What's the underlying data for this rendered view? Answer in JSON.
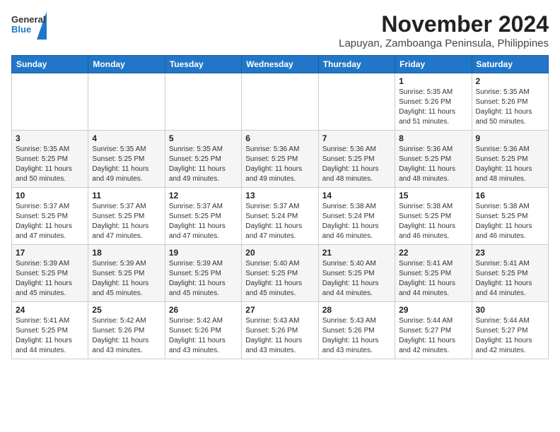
{
  "header": {
    "logo": {
      "general": "General",
      "blue": "Blue"
    },
    "title": "November 2024",
    "subtitle": "Lapuyan, Zamboanga Peninsula, Philippines"
  },
  "days_of_week": [
    "Sunday",
    "Monday",
    "Tuesday",
    "Wednesday",
    "Thursday",
    "Friday",
    "Saturday"
  ],
  "weeks": [
    [
      {
        "day": "",
        "info": ""
      },
      {
        "day": "",
        "info": ""
      },
      {
        "day": "",
        "info": ""
      },
      {
        "day": "",
        "info": ""
      },
      {
        "day": "",
        "info": ""
      },
      {
        "day": "1",
        "info": "Sunrise: 5:35 AM\nSunset: 5:26 PM\nDaylight: 11 hours and 51 minutes."
      },
      {
        "day": "2",
        "info": "Sunrise: 5:35 AM\nSunset: 5:26 PM\nDaylight: 11 hours and 50 minutes."
      }
    ],
    [
      {
        "day": "3",
        "info": "Sunrise: 5:35 AM\nSunset: 5:25 PM\nDaylight: 11 hours and 50 minutes."
      },
      {
        "day": "4",
        "info": "Sunrise: 5:35 AM\nSunset: 5:25 PM\nDaylight: 11 hours and 49 minutes."
      },
      {
        "day": "5",
        "info": "Sunrise: 5:35 AM\nSunset: 5:25 PM\nDaylight: 11 hours and 49 minutes."
      },
      {
        "day": "6",
        "info": "Sunrise: 5:36 AM\nSunset: 5:25 PM\nDaylight: 11 hours and 49 minutes."
      },
      {
        "day": "7",
        "info": "Sunrise: 5:36 AM\nSunset: 5:25 PM\nDaylight: 11 hours and 48 minutes."
      },
      {
        "day": "8",
        "info": "Sunrise: 5:36 AM\nSunset: 5:25 PM\nDaylight: 11 hours and 48 minutes."
      },
      {
        "day": "9",
        "info": "Sunrise: 5:36 AM\nSunset: 5:25 PM\nDaylight: 11 hours and 48 minutes."
      }
    ],
    [
      {
        "day": "10",
        "info": "Sunrise: 5:37 AM\nSunset: 5:25 PM\nDaylight: 11 hours and 47 minutes."
      },
      {
        "day": "11",
        "info": "Sunrise: 5:37 AM\nSunset: 5:25 PM\nDaylight: 11 hours and 47 minutes."
      },
      {
        "day": "12",
        "info": "Sunrise: 5:37 AM\nSunset: 5:25 PM\nDaylight: 11 hours and 47 minutes."
      },
      {
        "day": "13",
        "info": "Sunrise: 5:37 AM\nSunset: 5:24 PM\nDaylight: 11 hours and 47 minutes."
      },
      {
        "day": "14",
        "info": "Sunrise: 5:38 AM\nSunset: 5:24 PM\nDaylight: 11 hours and 46 minutes."
      },
      {
        "day": "15",
        "info": "Sunrise: 5:38 AM\nSunset: 5:25 PM\nDaylight: 11 hours and 46 minutes."
      },
      {
        "day": "16",
        "info": "Sunrise: 5:38 AM\nSunset: 5:25 PM\nDaylight: 11 hours and 46 minutes."
      }
    ],
    [
      {
        "day": "17",
        "info": "Sunrise: 5:39 AM\nSunset: 5:25 PM\nDaylight: 11 hours and 45 minutes."
      },
      {
        "day": "18",
        "info": "Sunrise: 5:39 AM\nSunset: 5:25 PM\nDaylight: 11 hours and 45 minutes."
      },
      {
        "day": "19",
        "info": "Sunrise: 5:39 AM\nSunset: 5:25 PM\nDaylight: 11 hours and 45 minutes."
      },
      {
        "day": "20",
        "info": "Sunrise: 5:40 AM\nSunset: 5:25 PM\nDaylight: 11 hours and 45 minutes."
      },
      {
        "day": "21",
        "info": "Sunrise: 5:40 AM\nSunset: 5:25 PM\nDaylight: 11 hours and 44 minutes."
      },
      {
        "day": "22",
        "info": "Sunrise: 5:41 AM\nSunset: 5:25 PM\nDaylight: 11 hours and 44 minutes."
      },
      {
        "day": "23",
        "info": "Sunrise: 5:41 AM\nSunset: 5:25 PM\nDaylight: 11 hours and 44 minutes."
      }
    ],
    [
      {
        "day": "24",
        "info": "Sunrise: 5:41 AM\nSunset: 5:25 PM\nDaylight: 11 hours and 44 minutes."
      },
      {
        "day": "25",
        "info": "Sunrise: 5:42 AM\nSunset: 5:26 PM\nDaylight: 11 hours and 43 minutes."
      },
      {
        "day": "26",
        "info": "Sunrise: 5:42 AM\nSunset: 5:26 PM\nDaylight: 11 hours and 43 minutes."
      },
      {
        "day": "27",
        "info": "Sunrise: 5:43 AM\nSunset: 5:26 PM\nDaylight: 11 hours and 43 minutes."
      },
      {
        "day": "28",
        "info": "Sunrise: 5:43 AM\nSunset: 5:26 PM\nDaylight: 11 hours and 43 minutes."
      },
      {
        "day": "29",
        "info": "Sunrise: 5:44 AM\nSunset: 5:27 PM\nDaylight: 11 hours and 42 minutes."
      },
      {
        "day": "30",
        "info": "Sunrise: 5:44 AM\nSunset: 5:27 PM\nDaylight: 11 hours and 42 minutes."
      }
    ]
  ]
}
